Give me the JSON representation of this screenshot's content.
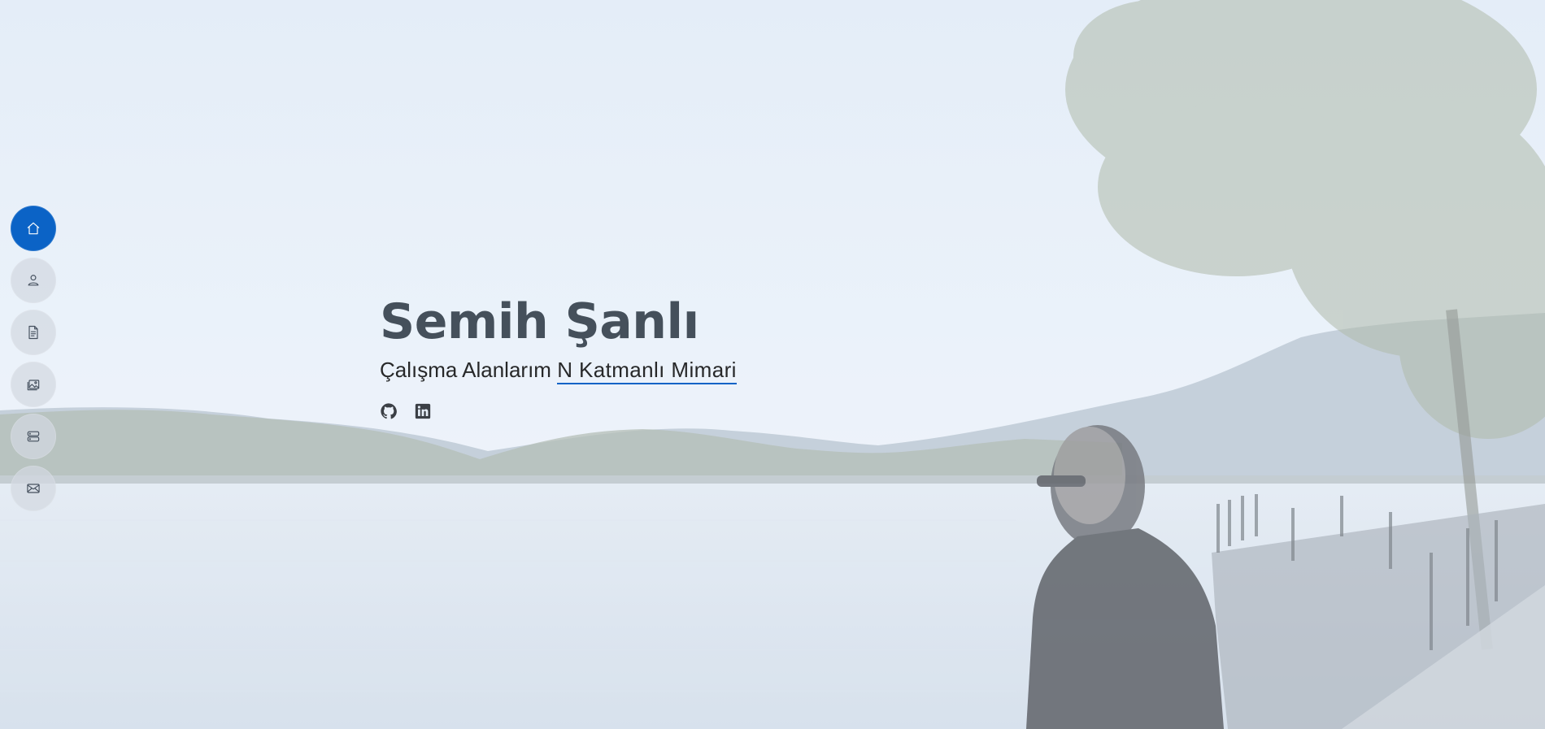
{
  "hero": {
    "name": "Semih Şanlı",
    "subtitle_prefix": "Çalışma Alanlarım",
    "typed_role": "N Katmanlı Mimari"
  },
  "nav": {
    "items": [
      {
        "id": "home",
        "icon": "home-icon",
        "active": true
      },
      {
        "id": "about",
        "icon": "person-icon",
        "active": false
      },
      {
        "id": "resume",
        "icon": "file-text-icon",
        "active": false
      },
      {
        "id": "portfolio",
        "icon": "images-icon",
        "active": false
      },
      {
        "id": "services",
        "icon": "server-icon",
        "active": false
      },
      {
        "id": "contact",
        "icon": "envelope-icon",
        "active": false
      }
    ]
  },
  "social": {
    "items": [
      {
        "id": "github",
        "icon": "github-icon"
      },
      {
        "id": "linkedin",
        "icon": "linkedin-icon"
      }
    ]
  },
  "colors": {
    "accent": "#0b63c6",
    "name_text": "#45505b",
    "subtitle_text": "#272829",
    "nav_inactive_bg": "#d2d8e0"
  }
}
